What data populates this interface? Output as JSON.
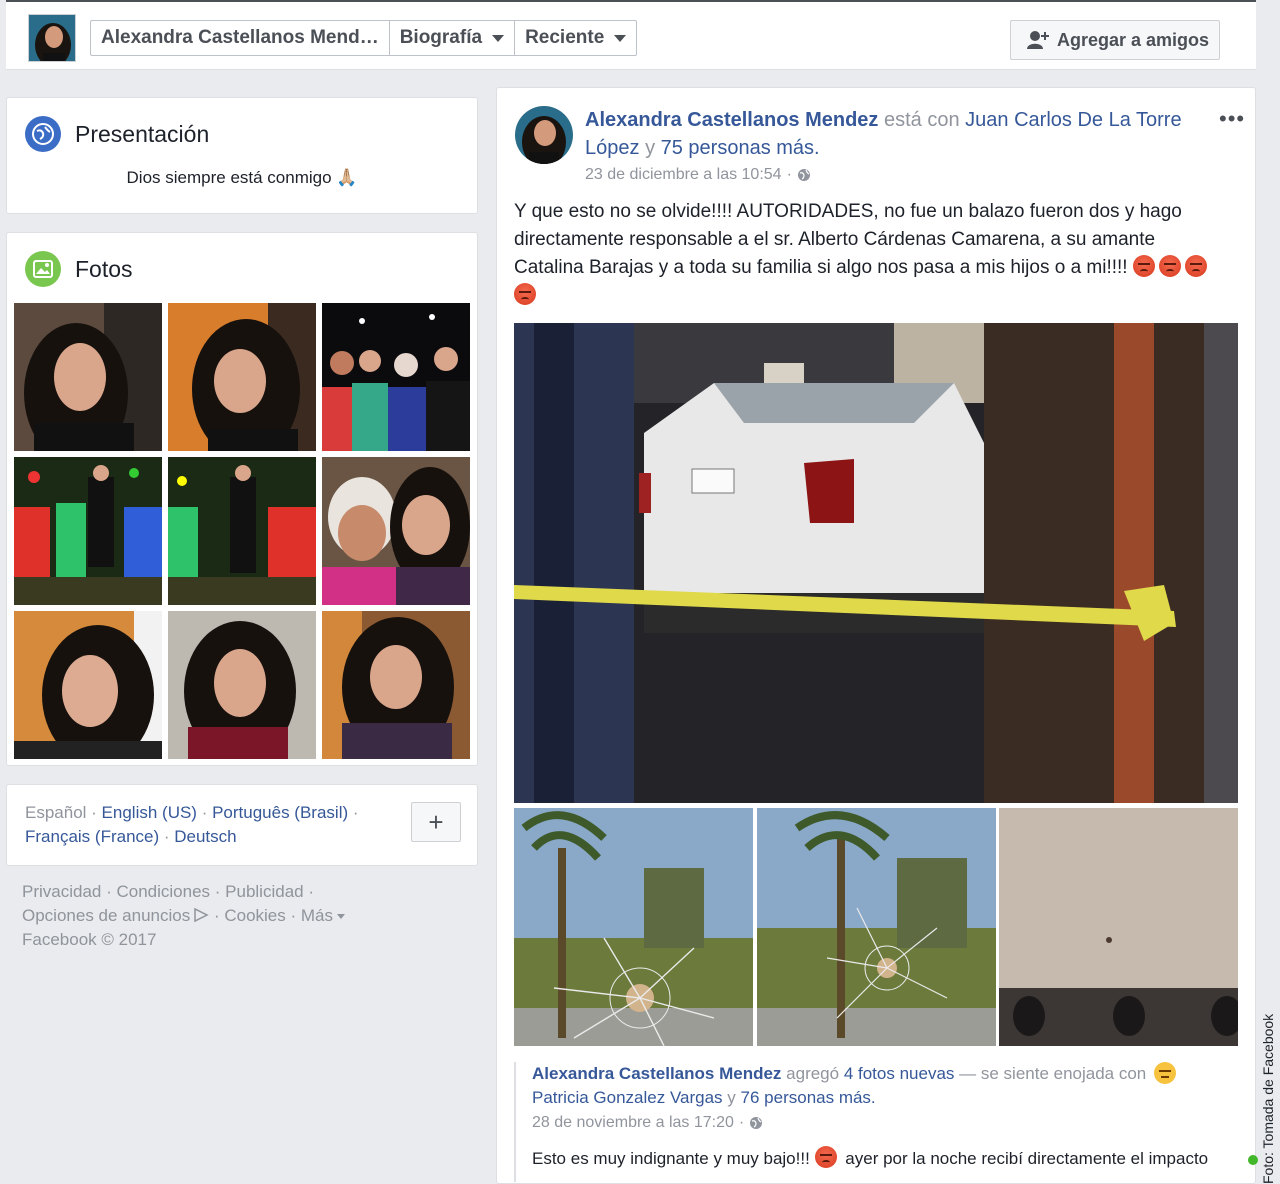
{
  "topbar": {
    "profile_name": "Alexandra Castellanos Mend…",
    "timeline_label": "Biografía",
    "recent_label": "Reciente",
    "add_friend_label": "Agregar a amigos"
  },
  "intro": {
    "title": "Presentación",
    "bio": "Dios siempre está conmigo 🙏🏼"
  },
  "photos": {
    "title": "Fotos"
  },
  "languages": {
    "current": "Español",
    "sep": " · ",
    "items": [
      "English (US)",
      "Português (Brasil)",
      "Français (France)",
      "Deutsch"
    ],
    "more_label": "+"
  },
  "footer": {
    "privacy": "Privacidad",
    "terms": "Condiciones",
    "ads": "Publicidad",
    "ad_choices": "Opciones de anuncios",
    "cookies": "Cookies",
    "more": "Más",
    "copyright": "Facebook © 2017"
  },
  "post": {
    "author": "Alexandra Castellanos Mendez",
    "with_text": "está con",
    "tagged": "Juan Carlos De La Torre López",
    "and_text": "y",
    "others": "75 personas más.",
    "timestamp": "23 de diciembre a las 10:54",
    "body": "Y que esto no se olvide!!!! AUTORIDADES, no fue un balazo fueron dos y hago directamente responsable a el sr. Alberto Cárdenas Camarena, a su amante Catalina Barajas y a toda su familia si algo nos pasa a mis hijos o a mi!!!!"
  },
  "shared_post": {
    "author": "Alexandra Castellanos Mendez",
    "added_text": "agregó",
    "photos_link": "4 fotos nuevas",
    "feeling_text": "— se siente enojada con",
    "tagged": "Patricia Gonzalez Vargas",
    "and_text": "y",
    "others": "76 personas más.",
    "timestamp": "28 de noviembre a las 17:20",
    "body_start": "Esto es muy indignante y muy bajo!!!",
    "body_end": "ayer por la noche recibí directamente el impacto"
  },
  "photo_credit": "Foto: Tomada de Facebook"
}
